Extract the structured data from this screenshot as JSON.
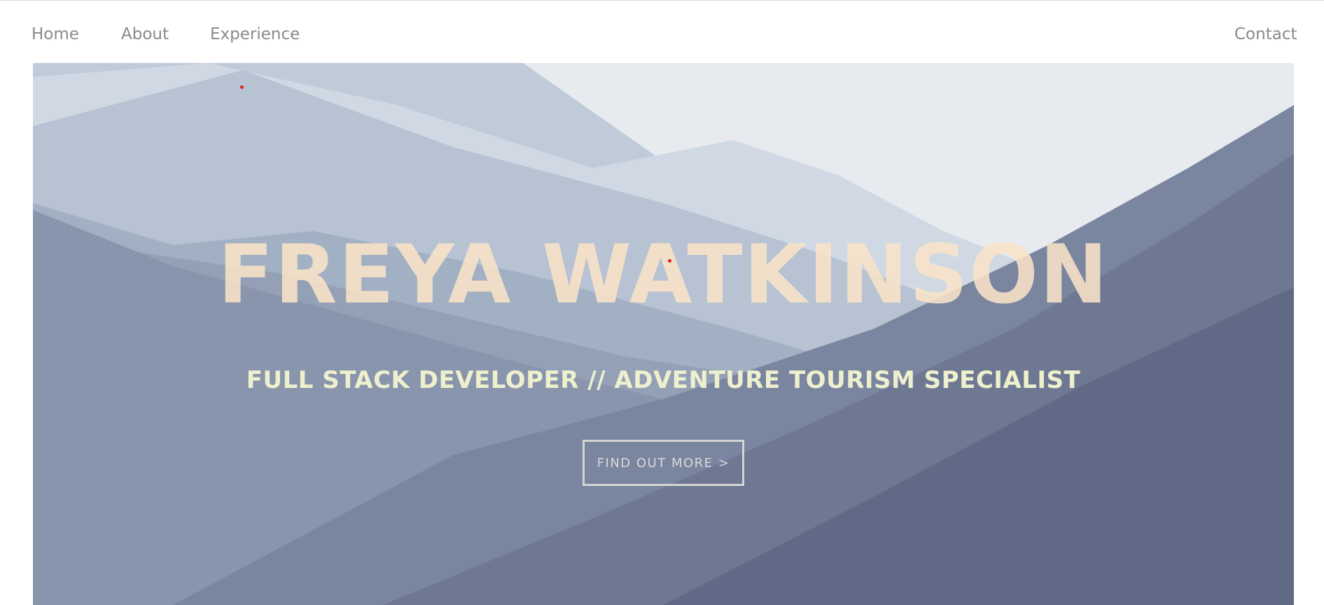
{
  "nav": {
    "home": "Home",
    "about": "About",
    "experience": "Experience",
    "contact": "Contact"
  },
  "hero": {
    "title": "FREYA WATKINSON",
    "subtitle": "FULL STACK DEVELOPER // ADVENTURE TOURISM SPECIALIST",
    "cta_label": "FIND OUT MORE >"
  },
  "colors": {
    "nav_text": "#8a8a8a",
    "title": "#f9e2c8",
    "subtitle": "#eef0cd",
    "cta_border": "#d4d4d4",
    "marker": "#e0231c"
  }
}
